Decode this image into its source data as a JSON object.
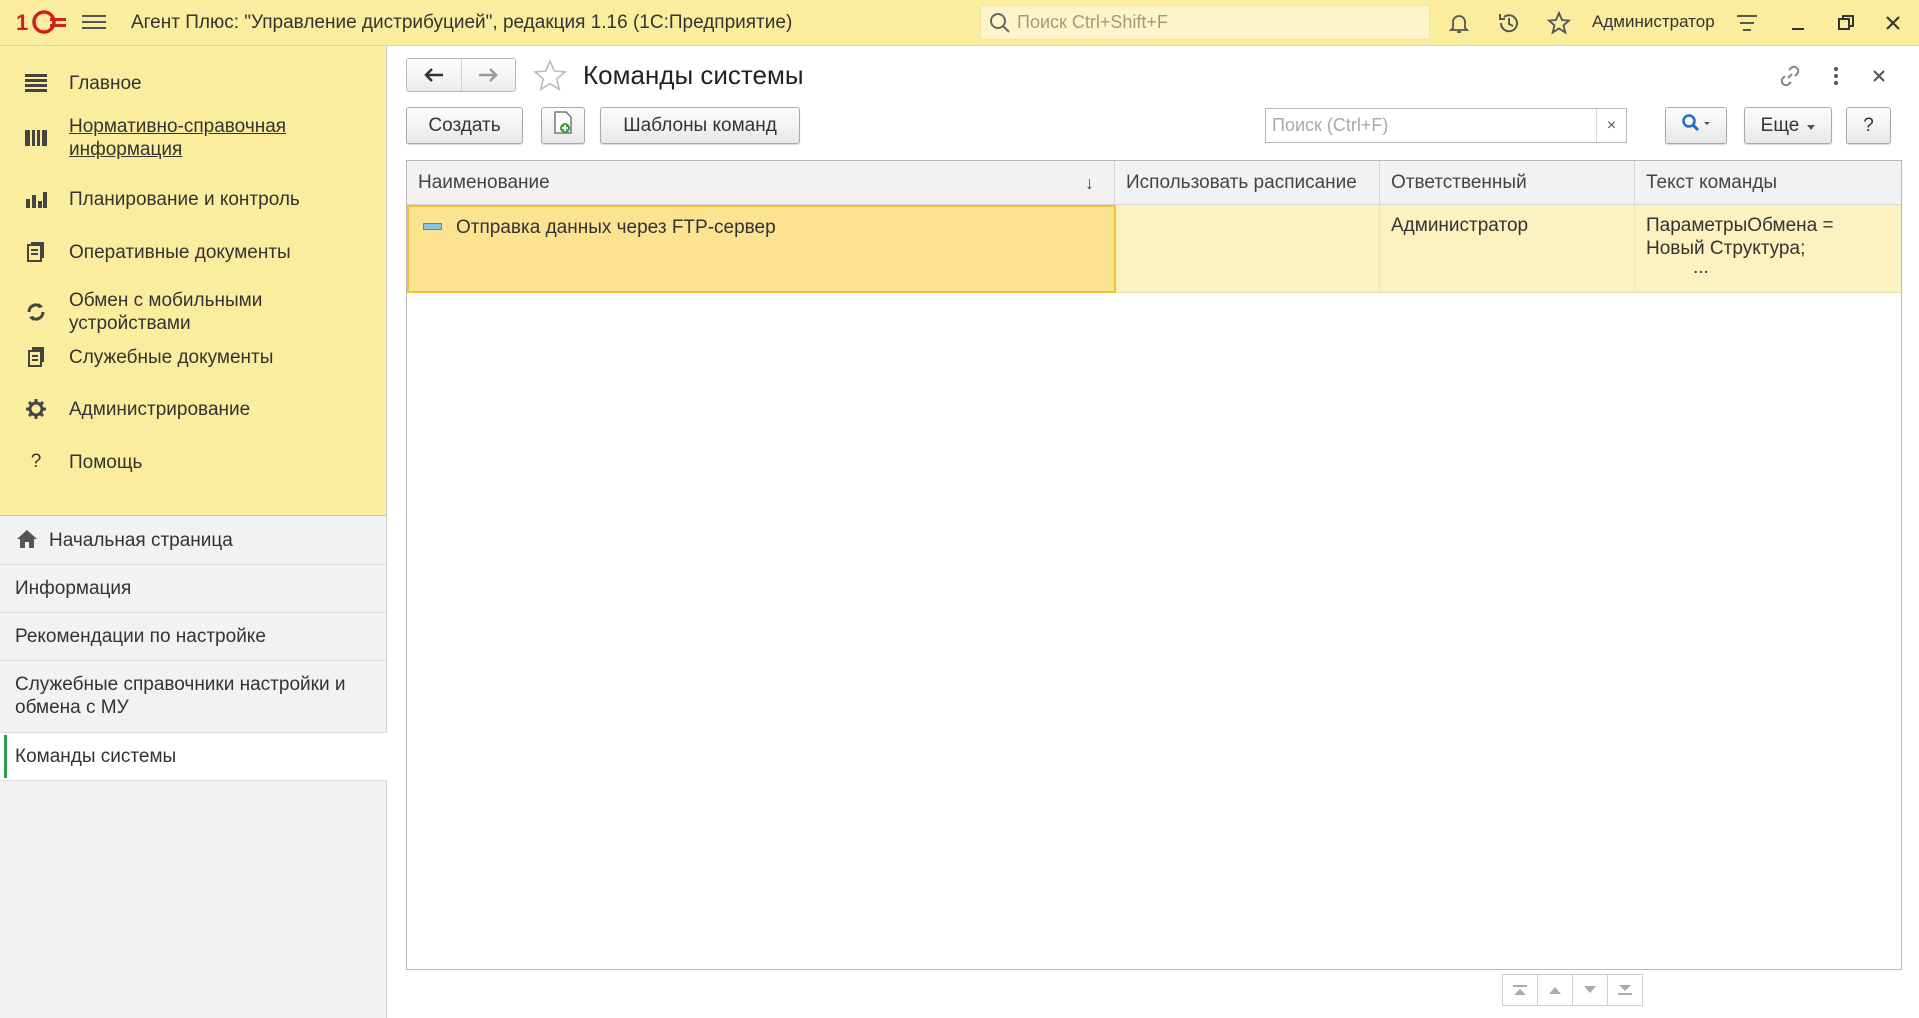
{
  "app": {
    "title": "Агент Плюс: \"Управление дистрибуцией\", редакция 1.16  (1С:Предприятие)",
    "search_placeholder": "Поиск Ctrl+Shift+F",
    "user": "Администратор",
    "accent": "#fbed9e"
  },
  "sections": [
    {
      "label": "Главное",
      "icon": "list-icon"
    },
    {
      "label": "Нормативно-справочная информация",
      "icon": "catalog-icon"
    },
    {
      "label": "Планирование и контроль",
      "icon": "chart-icon"
    },
    {
      "label": "Оперативные документы",
      "icon": "documents-icon"
    },
    {
      "label": "Обмен с мобильными устройствами",
      "icon": "sync-icon"
    },
    {
      "label": "Служебные документы",
      "icon": "service-docs-icon"
    },
    {
      "label": "Администрирование",
      "icon": "gear-icon"
    },
    {
      "label": "Помощь",
      "icon": "help-icon"
    }
  ],
  "nav": [
    {
      "label": "Начальная страница",
      "icon": "home-icon"
    },
    {
      "label": "Информация"
    },
    {
      "label": "Рекомендации по настройке"
    },
    {
      "label": "Служебные справочники настройки и обмена с МУ"
    },
    {
      "label": "Команды системы",
      "active": true
    }
  ],
  "page": {
    "title": "Команды системы",
    "create_label": "Создать",
    "templates_label": "Шаблоны команд",
    "search_placeholder": "Поиск (Ctrl+F)",
    "more_label": "Еще",
    "help_label": "?",
    "clear_label": "×"
  },
  "table": {
    "columns": [
      "Наименование",
      "Использовать расписание",
      "Ответственный",
      "Текст команды"
    ],
    "sort_indicator": "↓",
    "rows": [
      {
        "name": "Отправка данных через FTP-сервер",
        "schedule": "",
        "responsible": "Администратор",
        "text_line1": "ПараметрыОбмена =",
        "text_line2": "Новый Структура;",
        "text_line3": "..."
      }
    ]
  }
}
